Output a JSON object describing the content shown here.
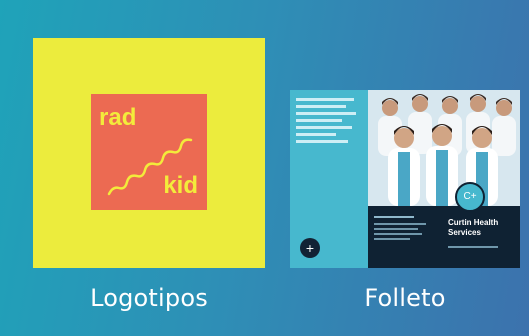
{
  "cards": [
    {
      "label": "Logotipos",
      "logo": {
        "top_word": "rad",
        "bottom_word": "kid"
      }
    },
    {
      "label": "Folleto",
      "brochure": {
        "badge": "C+",
        "title": "Curtin Health Services",
        "plus_icon": "+"
      }
    }
  ],
  "colors": {
    "logo_card_bg": "#ecec3d",
    "logo_square": "#ec6a52",
    "logo_text": "#f3eb3b",
    "brochure_teal": "#47b8ce",
    "brochure_navy": "#0f2233"
  }
}
